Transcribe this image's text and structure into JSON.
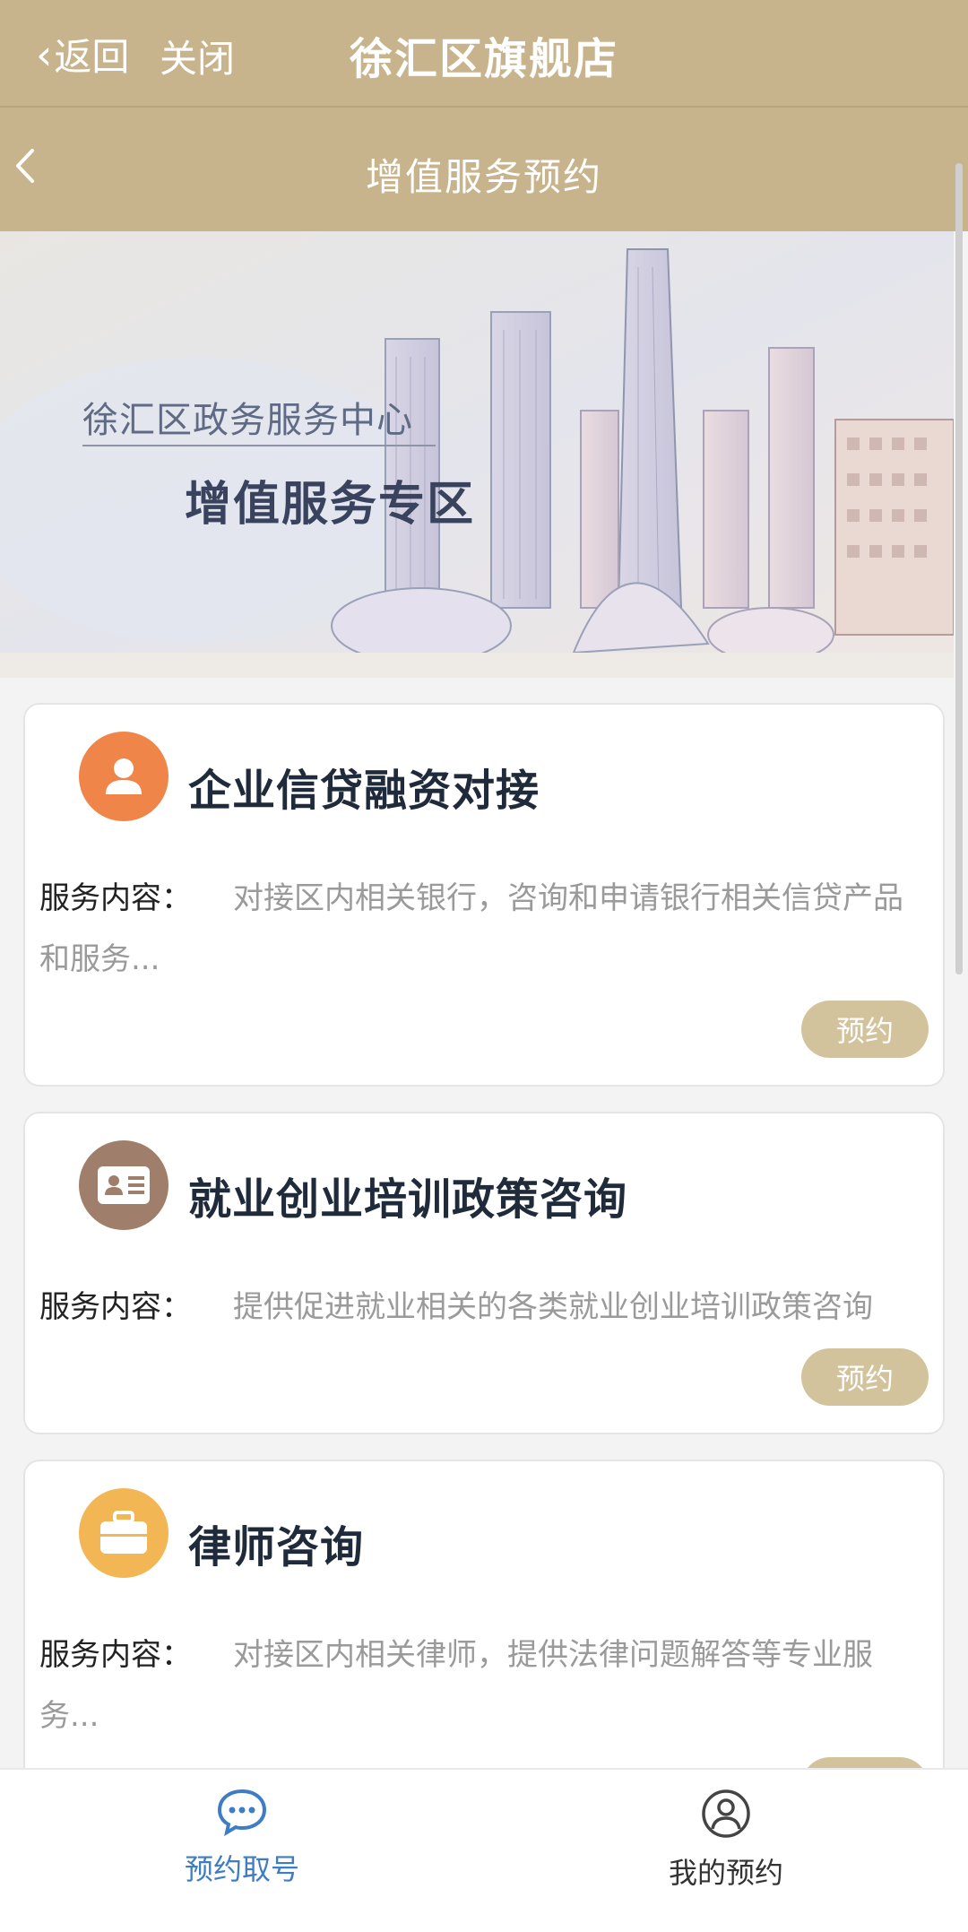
{
  "appbar": {
    "back_label": "返回",
    "close_label": "关闭",
    "title": "徐汇区旗舰店"
  },
  "subbar": {
    "title": "增值服务预约"
  },
  "banner": {
    "line1": "徐汇区政务服务中心",
    "line2": "增值服务专区"
  },
  "services": [
    {
      "title": "企业信贷融资对接",
      "desc_label": "服务内容：",
      "desc": "对接区内相关银行，咨询和申请银行相关信贷产品和服务...",
      "button": "预约",
      "icon": "person-icon",
      "icon_color": "#f0854a"
    },
    {
      "title": "就业创业培训政策咨询",
      "desc_label": "服务内容：",
      "desc": "提供促进就业相关的各类就业创业培训政策咨询",
      "button": "预约",
      "icon": "id-card-icon",
      "icon_color": "#a07e6c"
    },
    {
      "title": "律师咨询",
      "desc_label": "服务内容：",
      "desc": "对接区内相关律师，提供法律问题解答等专业服务...",
      "button": "预约",
      "icon": "briefcase-icon",
      "icon_color": "#f3b655"
    }
  ],
  "tabbar": {
    "items": [
      {
        "label": "预约取号",
        "icon": "chat-bubble-icon",
        "active": true
      },
      {
        "label": "我的预约",
        "icon": "user-circle-icon",
        "active": false
      }
    ]
  },
  "colors": {
    "theme": "#c8b48c",
    "button": "#d2c39d",
    "active_tab": "#3e7dc4"
  }
}
